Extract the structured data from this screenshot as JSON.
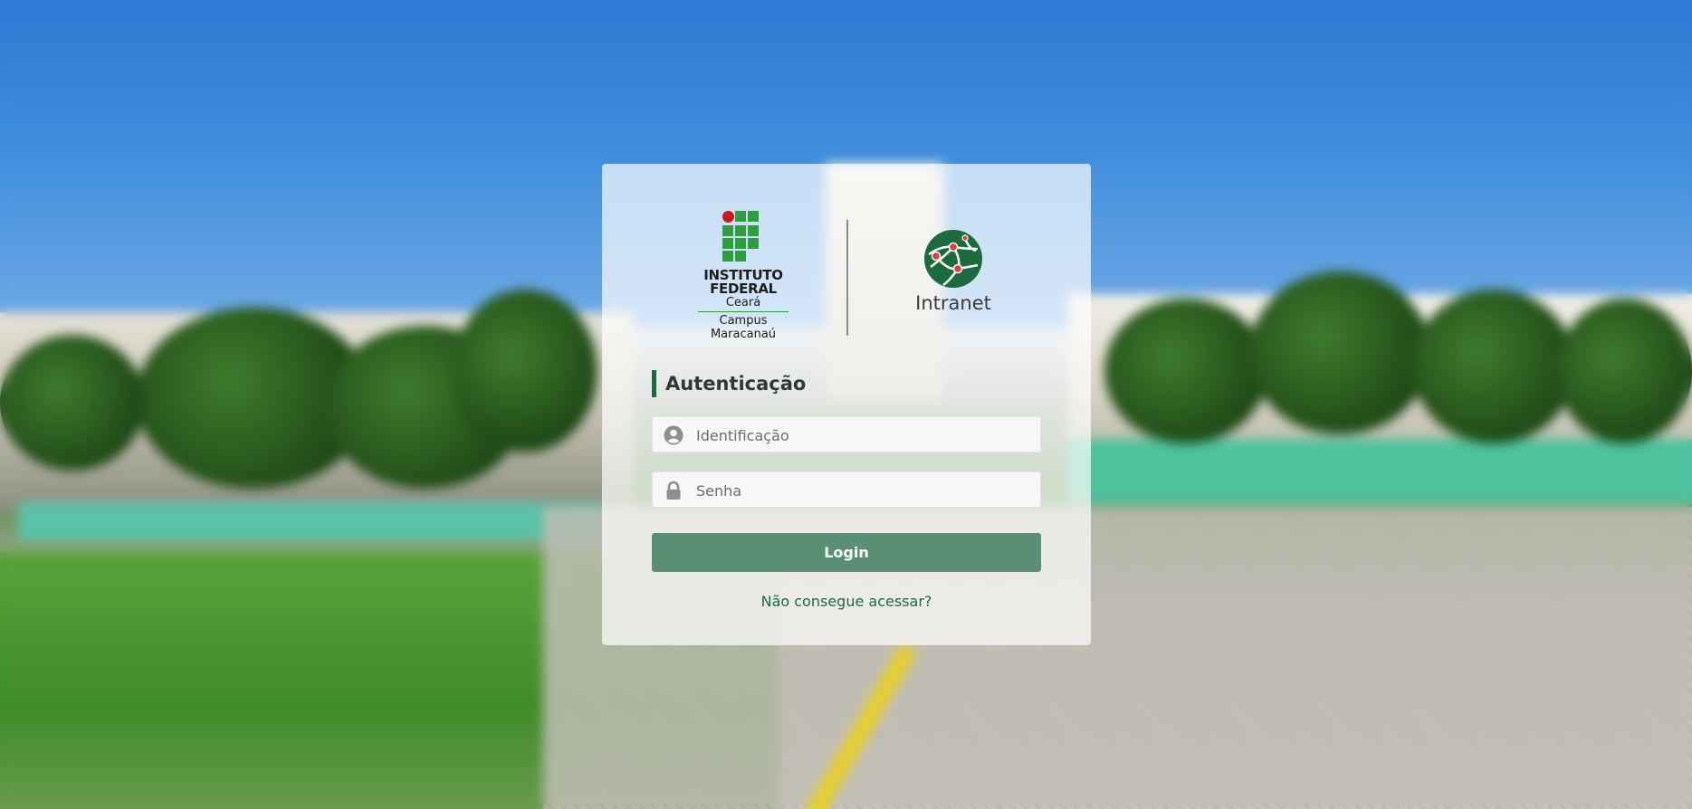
{
  "logos": {
    "institution_name": "INSTITUTO FEDERAL",
    "institution_state": "Ceará",
    "campus_line1": "Campus",
    "campus_line2": "Maracanaú",
    "app_name": "Intranet",
    "institution_logo_icon": "if-logo-icon",
    "app_logo_icon": "globe-network-icon"
  },
  "auth": {
    "heading": "Autenticação",
    "identification_placeholder": "Identificação",
    "identification_value": "",
    "password_placeholder": "Senha",
    "password_value": "",
    "login_label": "Login",
    "help_link": "Não consegue acessar?"
  },
  "colors": {
    "brand_green": "#1b6b3e",
    "button_green": "#5a8f76",
    "logo_red": "#c8191e",
    "logo_green": "#2f9e41"
  }
}
